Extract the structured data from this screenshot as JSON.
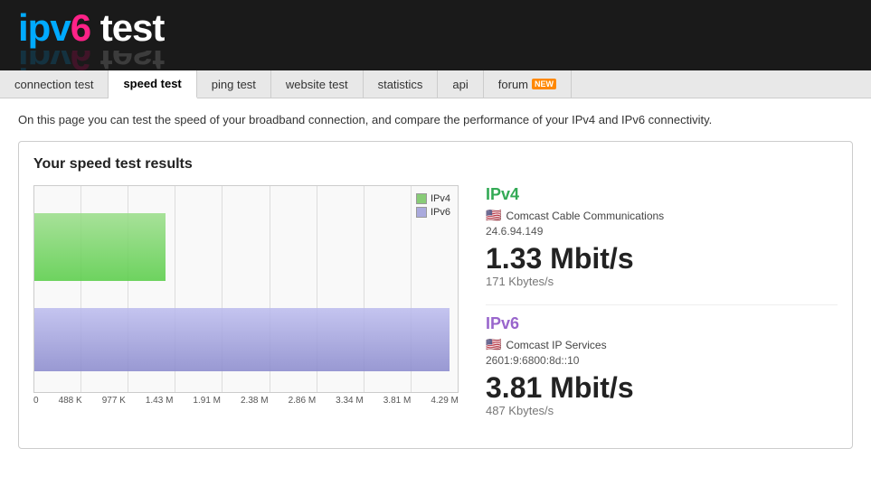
{
  "header": {
    "logo": {
      "ipv": "ipv",
      "six": "6",
      "space": " ",
      "test": "test"
    }
  },
  "nav": {
    "items": [
      {
        "id": "connection-test",
        "label": "connection test",
        "active": false
      },
      {
        "id": "speed-test",
        "label": "speed test",
        "active": true
      },
      {
        "id": "ping-test",
        "label": "ping test",
        "active": false
      },
      {
        "id": "website-test",
        "label": "website test",
        "active": false
      },
      {
        "id": "statistics",
        "label": "statistics",
        "active": false
      },
      {
        "id": "api",
        "label": "api",
        "active": false
      },
      {
        "id": "forum",
        "label": "forum",
        "active": false,
        "badge": "NEW"
      }
    ]
  },
  "intro": {
    "text": "On this page you can test the speed of your broadband connection, and compare the performance of your IPv4 and IPv6 connectivity."
  },
  "results": {
    "title": "Your speed test results",
    "legend": {
      "ipv4_label": "IPv4",
      "ipv6_label": "IPv6"
    },
    "x_axis": [
      "0",
      "488 K",
      "977 K",
      "1.43 M",
      "1.91 M",
      "2.38 M",
      "2.86 M",
      "3.34 M",
      "3.81 M",
      "4.29 M"
    ],
    "ipv4": {
      "label": "IPv4",
      "isp": "Comcast Cable Communications",
      "ip": "24.6.94.149",
      "speed_mbits": "1.33 Mbit/s",
      "speed_kbytes": "171 Kbytes/s"
    },
    "ipv6": {
      "label": "IPv6",
      "isp": "Comcast IP Services",
      "ip": "2601:9:6800:8d::10",
      "speed_mbits": "3.81 Mbit/s",
      "speed_kbytes": "487 Kbytes/s"
    }
  }
}
